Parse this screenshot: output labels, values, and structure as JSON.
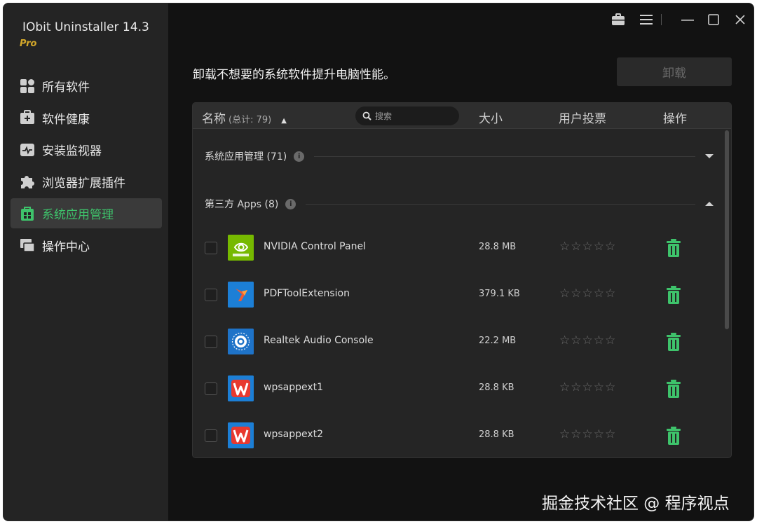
{
  "app": {
    "title": "IObit Uninstaller 14.3",
    "edition": "Pro"
  },
  "sidebar": {
    "items": [
      {
        "label": "所有软件",
        "icon": "grid-apps-icon",
        "active": false
      },
      {
        "label": "软件健康",
        "icon": "health-kit-icon",
        "active": false
      },
      {
        "label": "安装监视器",
        "icon": "monitor-pulse-icon",
        "active": false
      },
      {
        "label": "浏览器扩展插件",
        "icon": "puzzle-icon",
        "active": false
      },
      {
        "label": "系统应用管理",
        "icon": "windows-app-icon",
        "active": true
      },
      {
        "label": "操作中心",
        "icon": "action-center-icon",
        "active": false
      }
    ]
  },
  "titlebar": {
    "icons": [
      "toolbox-icon",
      "menu-icon",
      "minimize-icon",
      "maximize-icon",
      "close-icon"
    ]
  },
  "main": {
    "subtitle": "卸载不想要的系统软件提升电脑性能。",
    "uninstall_label": "卸载"
  },
  "table": {
    "header": {
      "name_label": "名称",
      "count_label": "(总计: 79)",
      "search_placeholder": "搜索",
      "size_label": "大小",
      "rating_label": "用户投票",
      "action_label": "操作"
    },
    "groups": [
      {
        "label": "系统应用管理 (71)",
        "expanded": false
      },
      {
        "label": "第三方 Apps (8)",
        "expanded": true
      }
    ],
    "rows": [
      {
        "name": "NVIDIA Control Panel",
        "size": "28.8 MB",
        "icon": "nvidia-icon",
        "stars": "☆☆☆☆☆"
      },
      {
        "name": "PDFToolExtension",
        "size": "379.1 KB",
        "icon": "pdftool-icon",
        "stars": "☆☆☆☆☆"
      },
      {
        "name": "Realtek Audio Console",
        "size": "22.2 MB",
        "icon": "realtek-icon",
        "stars": "☆☆☆☆☆"
      },
      {
        "name": "wpsappext1",
        "size": "28.8 KB",
        "icon": "wps-icon",
        "stars": "☆☆☆☆☆"
      },
      {
        "name": "wpsappext2",
        "size": "28.8 KB",
        "icon": "wps-icon",
        "stars": "☆☆☆☆☆"
      }
    ]
  },
  "watermark": "掘金技术社区 @ 程序视点",
  "colors": {
    "accent_green": "#3ec36b",
    "edition_gold": "#d4a82a",
    "background": "#121212",
    "sidebar": "#242424"
  }
}
